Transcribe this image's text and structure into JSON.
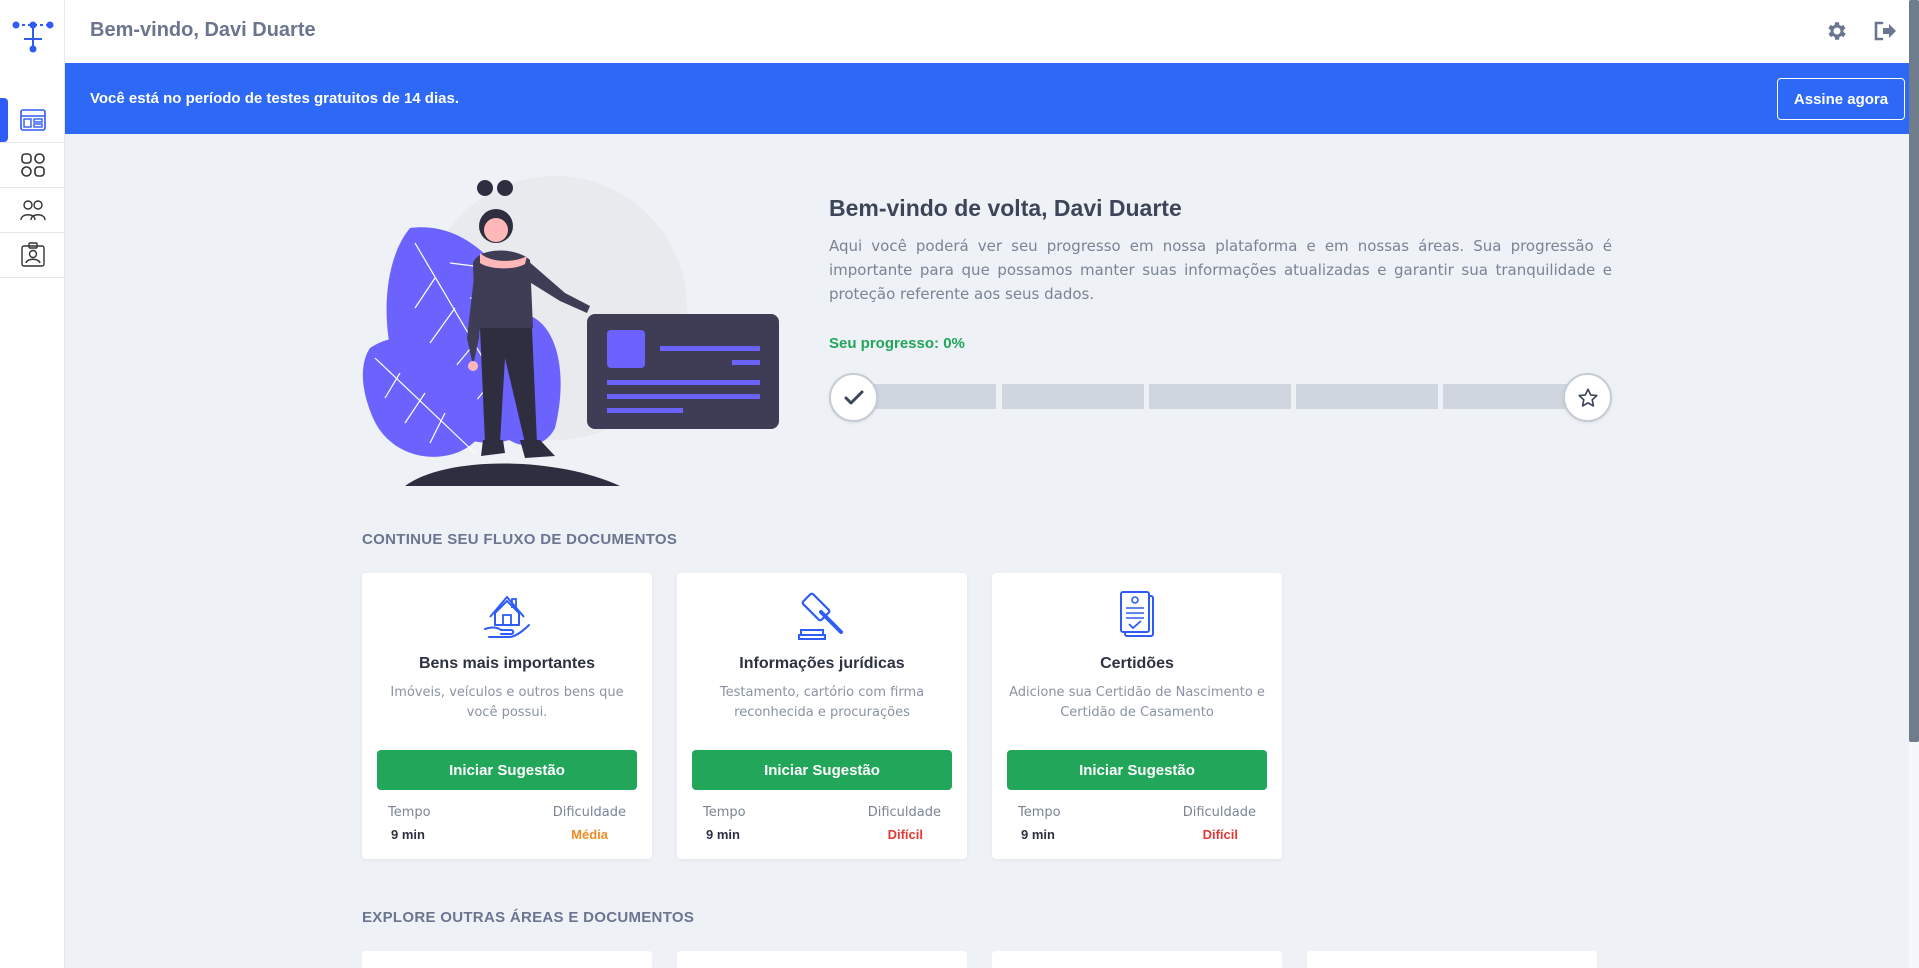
{
  "header": {
    "welcome": "Bem-vindo, Davi Duarte",
    "settings_icon": "gear-icon",
    "logout_icon": "logout-icon"
  },
  "sidebar": {
    "logo_icon": "network-logo-icon",
    "items": [
      {
        "name": "dashboard",
        "icon": "dashboard-icon",
        "active": true
      },
      {
        "name": "areas",
        "icon": "grid-icon",
        "active": false
      },
      {
        "name": "people",
        "icon": "people-icon",
        "active": false
      },
      {
        "name": "profile",
        "icon": "id-card-icon",
        "active": false
      }
    ]
  },
  "banner": {
    "text": "Você está no período de testes gratuitos de 14 dias.",
    "button": "Assine agora"
  },
  "hero": {
    "title": "Bem-vindo de volta, Davi Duarte",
    "description": "Aqui você poderá ver seu progresso em nossa plataforma e em nossas áreas. Sua progressão é importante para que possamos manter suas informações atualizadas e garantir sua tranquilidade e proteção referente aos seus dados.",
    "progress_label": "Seu progresso: 0%",
    "progress_percent": 0
  },
  "sections": {
    "continue": "CONTINUE SEU FLUXO DE DOCUMENTOS",
    "explore": "EXPLORE OUTRAS ÁREAS E DOCUMENTOS"
  },
  "cards": [
    {
      "icon": "house-hand-icon",
      "title": "Bens mais importantes",
      "description": "Imóveis, veículos e outros bens que você possui.",
      "button": "Iniciar Sugestão",
      "time_label": "Tempo",
      "time_value": "9 min",
      "difficulty_label": "Dificuldade",
      "difficulty_value": "Média",
      "difficulty_color": "#f08a24"
    },
    {
      "icon": "gavel-icon",
      "title": "Informações jurídicas",
      "description": "Testamento, cartório com firma reconhecida e procurações",
      "button": "Iniciar Sugestão",
      "time_label": "Tempo",
      "time_value": "9 min",
      "difficulty_label": "Dificuldade",
      "difficulty_value": "Difícil",
      "difficulty_color": "#e53935"
    },
    {
      "icon": "certificate-icon",
      "title": "Certidões",
      "description": "Adicione sua Certidão de Nascimento e Certidão de Casamento",
      "button": "Iniciar Sugestão",
      "time_label": "Tempo",
      "time_value": "9 min",
      "difficulty_label": "Dificuldade",
      "difficulty_value": "Difícil",
      "difficulty_color": "#e53935"
    }
  ],
  "colors": {
    "primary": "#2d69f6",
    "success": "#21a65a",
    "warning": "#f08a24",
    "danger": "#e53935",
    "illustration": "#6c63ff"
  }
}
